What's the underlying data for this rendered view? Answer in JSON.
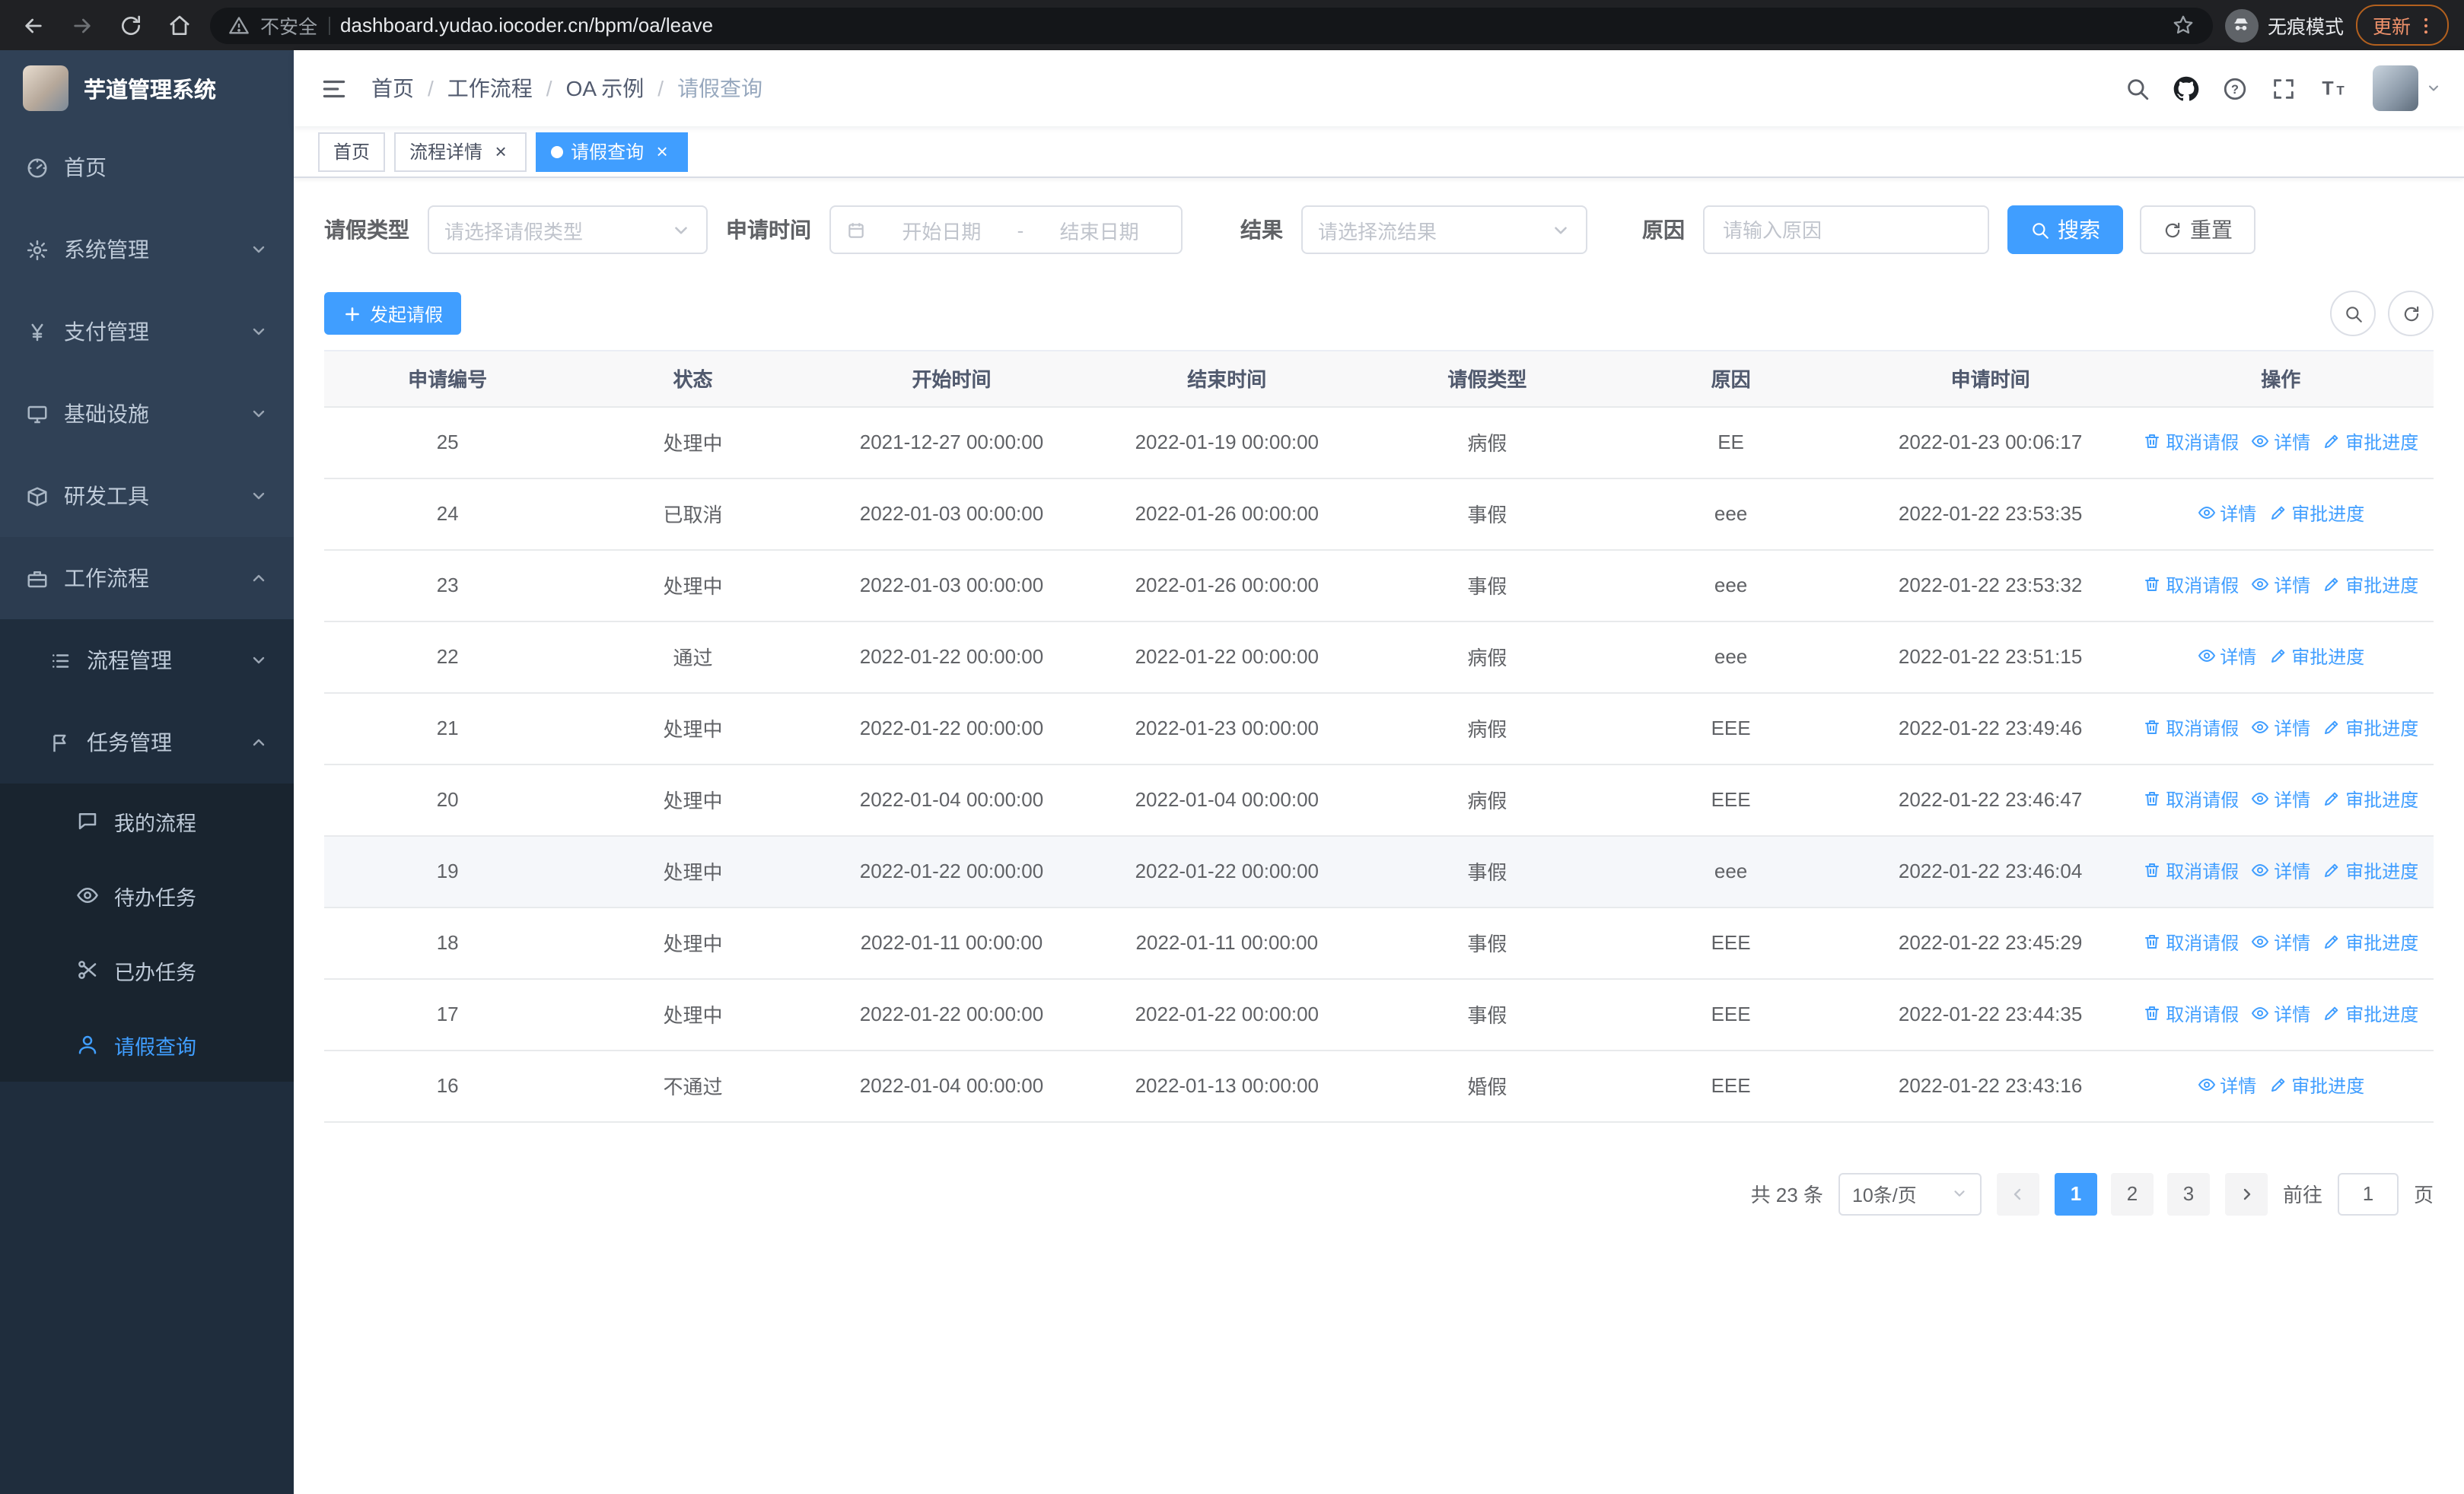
{
  "browser": {
    "security_warning": "不安全",
    "url": "dashboard.yudao.iocoder.cn/bpm/oa/leave",
    "incognito_label": "无痕模式",
    "update_label": "更新"
  },
  "sidebar": {
    "logo_title": "芋道管理系统",
    "items": [
      {
        "label": "首页"
      },
      {
        "label": "系统管理"
      },
      {
        "label": "支付管理"
      },
      {
        "label": "基础设施"
      },
      {
        "label": "研发工具"
      },
      {
        "label": "工作流程"
      }
    ],
    "submenu": [
      {
        "label": "流程管理"
      },
      {
        "label": "任务管理"
      }
    ],
    "tasks": [
      {
        "label": "我的流程"
      },
      {
        "label": "待办任务"
      },
      {
        "label": "已办任务"
      },
      {
        "label": "请假查询"
      }
    ]
  },
  "header": {
    "breadcrumb": [
      "首页",
      "工作流程",
      "OA 示例",
      "请假查询"
    ]
  },
  "tabs": [
    {
      "label": "首页"
    },
    {
      "label": "流程详情"
    },
    {
      "label": "请假查询"
    }
  ],
  "filters": {
    "leave_type_label": "请假类型",
    "leave_type_placeholder": "请选择请假类型",
    "apply_time_label": "申请时间",
    "date_start_placeholder": "开始日期",
    "date_separator": "-",
    "date_end_placeholder": "结束日期",
    "result_label": "结果",
    "result_placeholder": "请选择流结果",
    "reason_label": "原因",
    "reason_placeholder": "请输入原因",
    "search_button": "搜索",
    "reset_button": "重置"
  },
  "toolbar": {
    "create_button": "发起请假"
  },
  "table": {
    "columns": [
      "申请编号",
      "状态",
      "开始时间",
      "结束时间",
      "请假类型",
      "原因",
      "申请时间",
      "操作"
    ],
    "op_labels": {
      "cancel": "取消请假",
      "detail": "详情",
      "progress": "审批进度"
    },
    "op_icons": {
      "cancel": "i-trash",
      "detail": "i-eye",
      "progress": "i-pen"
    },
    "rows": [
      {
        "id": "25",
        "status": "处理中",
        "start": "2021-12-27 00:00:00",
        "end": "2022-01-19 00:00:00",
        "type": "病假",
        "reason": "EE",
        "apply": "2022-01-23 00:06:17",
        "ops": [
          "cancel",
          "detail",
          "progress"
        ]
      },
      {
        "id": "24",
        "status": "已取消",
        "start": "2022-01-03 00:00:00",
        "end": "2022-01-26 00:00:00",
        "type": "事假",
        "reason": "eee",
        "apply": "2022-01-22 23:53:35",
        "ops": [
          "detail",
          "progress"
        ]
      },
      {
        "id": "23",
        "status": "处理中",
        "start": "2022-01-03 00:00:00",
        "end": "2022-01-26 00:00:00",
        "type": "事假",
        "reason": "eee",
        "apply": "2022-01-22 23:53:32",
        "ops": [
          "cancel",
          "detail",
          "progress"
        ]
      },
      {
        "id": "22",
        "status": "通过",
        "start": "2022-01-22 00:00:00",
        "end": "2022-01-22 00:00:00",
        "type": "病假",
        "reason": "eee",
        "apply": "2022-01-22 23:51:15",
        "ops": [
          "detail",
          "progress"
        ]
      },
      {
        "id": "21",
        "status": "处理中",
        "start": "2022-01-22 00:00:00",
        "end": "2022-01-23 00:00:00",
        "type": "病假",
        "reason": "EEE",
        "apply": "2022-01-22 23:49:46",
        "ops": [
          "cancel",
          "detail",
          "progress"
        ]
      },
      {
        "id": "20",
        "status": "处理中",
        "start": "2022-01-04 00:00:00",
        "end": "2022-01-04 00:00:00",
        "type": "病假",
        "reason": "EEE",
        "apply": "2022-01-22 23:46:47",
        "ops": [
          "cancel",
          "detail",
          "progress"
        ]
      },
      {
        "id": "19",
        "status": "处理中",
        "start": "2022-01-22 00:00:00",
        "end": "2022-01-22 00:00:00",
        "type": "事假",
        "reason": "eee",
        "apply": "2022-01-22 23:46:04",
        "ops": [
          "cancel",
          "detail",
          "progress"
        ],
        "highlight": true
      },
      {
        "id": "18",
        "status": "处理中",
        "start": "2022-01-11 00:00:00",
        "end": "2022-01-11 00:00:00",
        "type": "事假",
        "reason": "EEE",
        "apply": "2022-01-22 23:45:29",
        "ops": [
          "cancel",
          "detail",
          "progress"
        ]
      },
      {
        "id": "17",
        "status": "处理中",
        "start": "2022-01-22 00:00:00",
        "end": "2022-01-22 00:00:00",
        "type": "事假",
        "reason": "EEE",
        "apply": "2022-01-22 23:44:35",
        "ops": [
          "cancel",
          "detail",
          "progress"
        ]
      },
      {
        "id": "16",
        "status": "不通过",
        "start": "2022-01-04 00:00:00",
        "end": "2022-01-13 00:00:00",
        "type": "婚假",
        "reason": "EEE",
        "apply": "2022-01-22 23:43:16",
        "ops": [
          "detail",
          "progress"
        ]
      }
    ]
  },
  "pagination": {
    "total_label": "共 23 条",
    "page_size": "10条/页",
    "pages": [
      "1",
      "2",
      "3"
    ],
    "active_page": "1",
    "goto_label": "前往",
    "goto_value": "1",
    "goto_suffix": "页"
  },
  "colors": {
    "primary": "#409EFF",
    "sidebar_bg": "#304156",
    "submenu_bg": "#1f2d3d"
  }
}
